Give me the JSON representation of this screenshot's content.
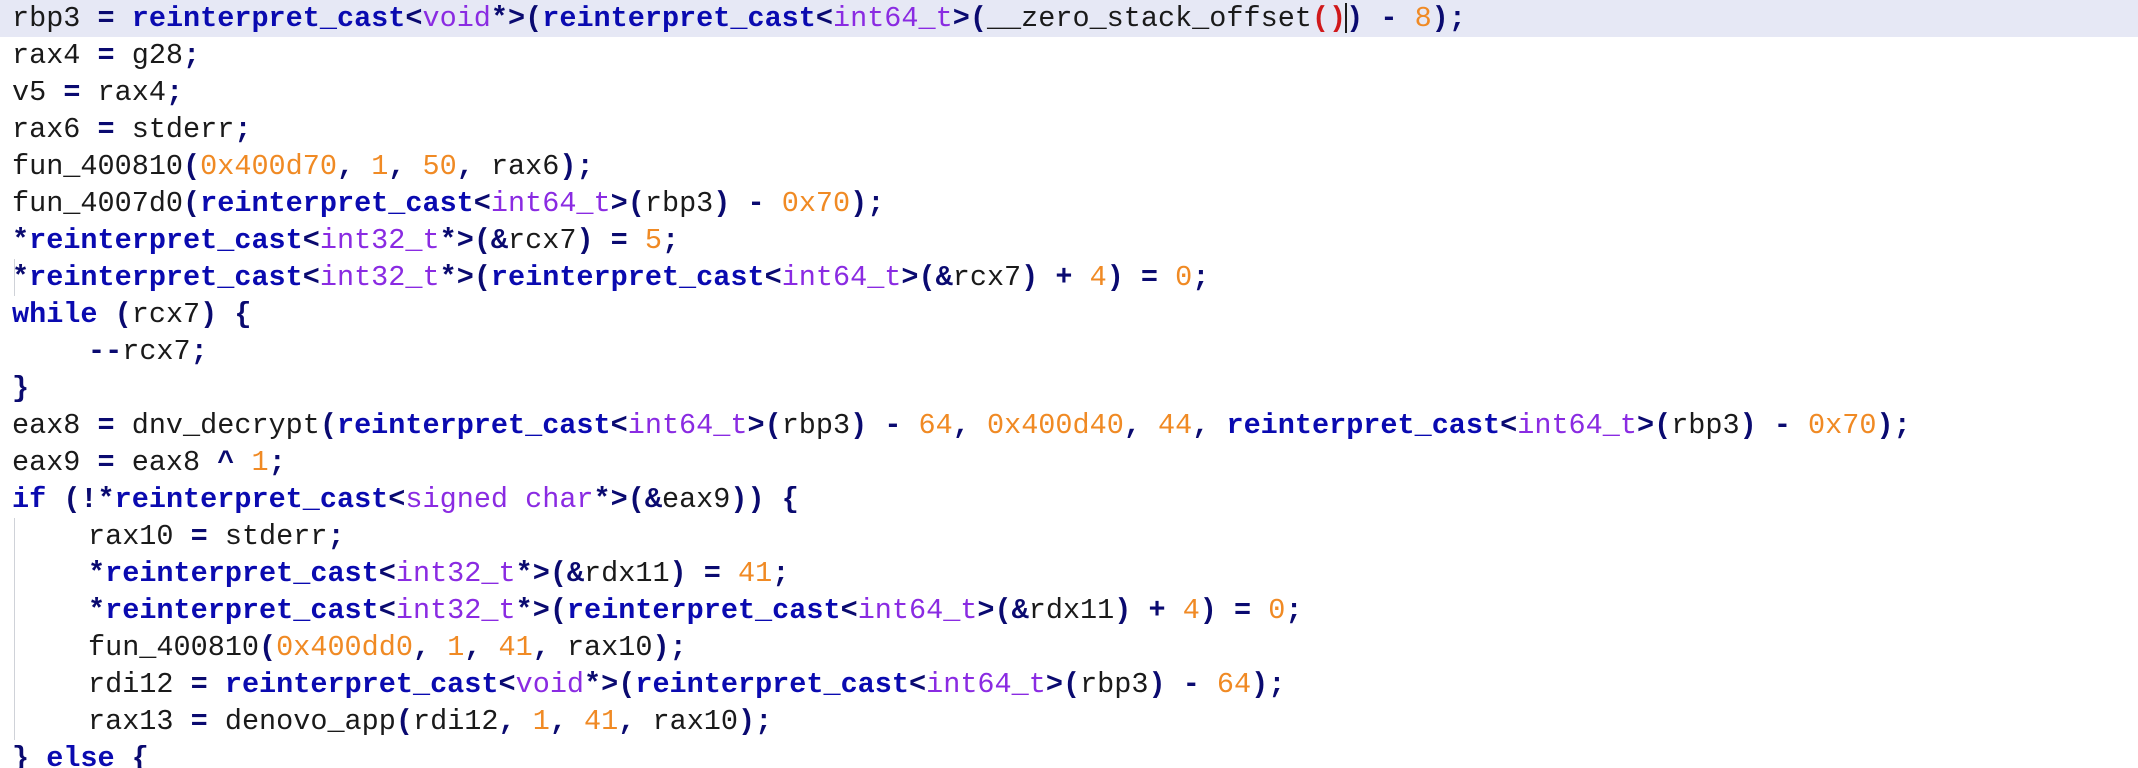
{
  "editor": {
    "lines": [
      {
        "indent": 0,
        "current": true,
        "tokens": [
          {
            "t": "rbp3 ",
            "c": "id"
          },
          {
            "t": "=",
            "c": "op"
          },
          {
            "t": " ",
            "c": "id"
          },
          {
            "t": "reinterpret_cast",
            "c": "kw"
          },
          {
            "t": "<",
            "c": "op"
          },
          {
            "t": "void",
            "c": "type"
          },
          {
            "t": "*>(",
            "c": "op"
          },
          {
            "t": "reinterpret_cast",
            "c": "kw"
          },
          {
            "t": "<",
            "c": "op"
          },
          {
            "t": "int64_t",
            "c": "type"
          },
          {
            "t": ">(",
            "c": "op"
          },
          {
            "t": "__zero_stack_offset",
            "c": "id"
          },
          {
            "t": "()",
            "c": "ctx"
          },
          {
            "t": "CURSOR",
            "c": "cursor"
          },
          {
            "t": ")",
            "c": "op"
          },
          {
            "t": " ",
            "c": "id"
          },
          {
            "t": "-",
            "c": "op"
          },
          {
            "t": " ",
            "c": "id"
          },
          {
            "t": "8",
            "c": "num"
          },
          {
            "t": ");",
            "c": "op"
          }
        ]
      },
      {
        "indent": 0,
        "tokens": [
          {
            "t": "rax4 ",
            "c": "id"
          },
          {
            "t": "=",
            "c": "op"
          },
          {
            "t": " g28",
            "c": "id"
          },
          {
            "t": ";",
            "c": "op"
          }
        ]
      },
      {
        "indent": 0,
        "tokens": [
          {
            "t": "v5 ",
            "c": "id"
          },
          {
            "t": "=",
            "c": "op"
          },
          {
            "t": " rax4",
            "c": "id"
          },
          {
            "t": ";",
            "c": "op"
          }
        ]
      },
      {
        "indent": 0,
        "tokens": [
          {
            "t": "rax6 ",
            "c": "id"
          },
          {
            "t": "=",
            "c": "op"
          },
          {
            "t": " stderr",
            "c": "id"
          },
          {
            "t": ";",
            "c": "op"
          }
        ]
      },
      {
        "indent": 0,
        "tokens": [
          {
            "t": "fun_400810",
            "c": "id"
          },
          {
            "t": "(",
            "c": "op"
          },
          {
            "t": "0x400d70",
            "c": "num"
          },
          {
            "t": ", ",
            "c": "op"
          },
          {
            "t": "1",
            "c": "num"
          },
          {
            "t": ", ",
            "c": "op"
          },
          {
            "t": "50",
            "c": "num"
          },
          {
            "t": ", ",
            "c": "op"
          },
          {
            "t": "rax6",
            "c": "id"
          },
          {
            "t": ");",
            "c": "op"
          }
        ]
      },
      {
        "indent": 0,
        "tokens": [
          {
            "t": "fun_4007d0",
            "c": "id"
          },
          {
            "t": "(",
            "c": "op"
          },
          {
            "t": "reinterpret_cast",
            "c": "kw"
          },
          {
            "t": "<",
            "c": "op"
          },
          {
            "t": "int64_t",
            "c": "type"
          },
          {
            "t": ">(",
            "c": "op"
          },
          {
            "t": "rbp3",
            "c": "id"
          },
          {
            "t": ")",
            "c": "op"
          },
          {
            "t": " ",
            "c": "id"
          },
          {
            "t": "-",
            "c": "op"
          },
          {
            "t": " ",
            "c": "id"
          },
          {
            "t": "0x70",
            "c": "num"
          },
          {
            "t": ");",
            "c": "op"
          }
        ]
      },
      {
        "indent": 0,
        "tokens": [
          {
            "t": "*",
            "c": "op"
          },
          {
            "t": "reinterpret_cast",
            "c": "kw"
          },
          {
            "t": "<",
            "c": "op"
          },
          {
            "t": "int32_t",
            "c": "type"
          },
          {
            "t": "*>(&",
            "c": "op"
          },
          {
            "t": "rcx7",
            "c": "id"
          },
          {
            "t": ")",
            "c": "op"
          },
          {
            "t": " ",
            "c": "id"
          },
          {
            "t": "=",
            "c": "op"
          },
          {
            "t": " ",
            "c": "id"
          },
          {
            "t": "5",
            "c": "num"
          },
          {
            "t": ";",
            "c": "op"
          }
        ]
      },
      {
        "indent": 0,
        "tokens": [
          {
            "t": "*",
            "c": "op"
          },
          {
            "t": "reinterpret_cast",
            "c": "kw"
          },
          {
            "t": "<",
            "c": "op"
          },
          {
            "t": "int32_t",
            "c": "type"
          },
          {
            "t": "*>(",
            "c": "op"
          },
          {
            "t": "reinterpret_cast",
            "c": "kw"
          },
          {
            "t": "<",
            "c": "op"
          },
          {
            "t": "int64_t",
            "c": "type"
          },
          {
            "t": ">(&",
            "c": "op"
          },
          {
            "t": "rcx7",
            "c": "id"
          },
          {
            "t": ")",
            "c": "op"
          },
          {
            "t": " ",
            "c": "id"
          },
          {
            "t": "+",
            "c": "op"
          },
          {
            "t": " ",
            "c": "id"
          },
          {
            "t": "4",
            "c": "num"
          },
          {
            "t": ")",
            "c": "op"
          },
          {
            "t": " ",
            "c": "id"
          },
          {
            "t": "=",
            "c": "op"
          },
          {
            "t": " ",
            "c": "id"
          },
          {
            "t": "0",
            "c": "num"
          },
          {
            "t": ";",
            "c": "op"
          }
        ]
      },
      {
        "indent": 0,
        "tokens": [
          {
            "t": "while",
            "c": "kw"
          },
          {
            "t": " (",
            "c": "op"
          },
          {
            "t": "rcx7",
            "c": "id"
          },
          {
            "t": ") {",
            "c": "op"
          }
        ]
      },
      {
        "indent": 1,
        "tokens": [
          {
            "t": "--",
            "c": "op"
          },
          {
            "t": "rcx7",
            "c": "id"
          },
          {
            "t": ";",
            "c": "op"
          }
        ]
      },
      {
        "indent": 0,
        "tokens": [
          {
            "t": "}",
            "c": "op"
          }
        ]
      },
      {
        "indent": 0,
        "tokens": [
          {
            "t": "eax8 ",
            "c": "id"
          },
          {
            "t": "=",
            "c": "op"
          },
          {
            "t": " dnv_decrypt",
            "c": "id"
          },
          {
            "t": "(",
            "c": "op"
          },
          {
            "t": "reinterpret_cast",
            "c": "kw"
          },
          {
            "t": "<",
            "c": "op"
          },
          {
            "t": "int64_t",
            "c": "type"
          },
          {
            "t": ">(",
            "c": "op"
          },
          {
            "t": "rbp3",
            "c": "id"
          },
          {
            "t": ")",
            "c": "op"
          },
          {
            "t": " ",
            "c": "id"
          },
          {
            "t": "-",
            "c": "op"
          },
          {
            "t": " ",
            "c": "id"
          },
          {
            "t": "64",
            "c": "num"
          },
          {
            "t": ", ",
            "c": "op"
          },
          {
            "t": "0x400d40",
            "c": "num"
          },
          {
            "t": ", ",
            "c": "op"
          },
          {
            "t": "44",
            "c": "num"
          },
          {
            "t": ", ",
            "c": "op"
          },
          {
            "t": "reinterpret_cast",
            "c": "kw"
          },
          {
            "t": "<",
            "c": "op"
          },
          {
            "t": "int64_t",
            "c": "type"
          },
          {
            "t": ">(",
            "c": "op"
          },
          {
            "t": "rbp3",
            "c": "id"
          },
          {
            "t": ")",
            "c": "op"
          },
          {
            "t": " ",
            "c": "id"
          },
          {
            "t": "-",
            "c": "op"
          },
          {
            "t": " ",
            "c": "id"
          },
          {
            "t": "0x70",
            "c": "num"
          },
          {
            "t": ");",
            "c": "op"
          }
        ]
      },
      {
        "indent": 0,
        "tokens": [
          {
            "t": "eax9 ",
            "c": "id"
          },
          {
            "t": "=",
            "c": "op"
          },
          {
            "t": " eax8 ",
            "c": "id"
          },
          {
            "t": "^",
            "c": "op"
          },
          {
            "t": " ",
            "c": "id"
          },
          {
            "t": "1",
            "c": "num"
          },
          {
            "t": ";",
            "c": "op"
          }
        ]
      },
      {
        "indent": 0,
        "tokens": [
          {
            "t": "if",
            "c": "kw"
          },
          {
            "t": " (!*",
            "c": "op"
          },
          {
            "t": "reinterpret_cast",
            "c": "kw"
          },
          {
            "t": "<",
            "c": "op"
          },
          {
            "t": "signed char",
            "c": "type"
          },
          {
            "t": "*>(&",
            "c": "op"
          },
          {
            "t": "eax9",
            "c": "id"
          },
          {
            "t": ")) {",
            "c": "op"
          }
        ]
      },
      {
        "indent": 1,
        "tokens": [
          {
            "t": "rax10 ",
            "c": "id"
          },
          {
            "t": "=",
            "c": "op"
          },
          {
            "t": " stderr",
            "c": "id"
          },
          {
            "t": ";",
            "c": "op"
          }
        ]
      },
      {
        "indent": 1,
        "tokens": [
          {
            "t": "*",
            "c": "op"
          },
          {
            "t": "reinterpret_cast",
            "c": "kw"
          },
          {
            "t": "<",
            "c": "op"
          },
          {
            "t": "int32_t",
            "c": "type"
          },
          {
            "t": "*>(&",
            "c": "op"
          },
          {
            "t": "rdx11",
            "c": "id"
          },
          {
            "t": ")",
            "c": "op"
          },
          {
            "t": " ",
            "c": "id"
          },
          {
            "t": "=",
            "c": "op"
          },
          {
            "t": " ",
            "c": "id"
          },
          {
            "t": "41",
            "c": "num"
          },
          {
            "t": ";",
            "c": "op"
          }
        ]
      },
      {
        "indent": 1,
        "tokens": [
          {
            "t": "*",
            "c": "op"
          },
          {
            "t": "reinterpret_cast",
            "c": "kw"
          },
          {
            "t": "<",
            "c": "op"
          },
          {
            "t": "int32_t",
            "c": "type"
          },
          {
            "t": "*>(",
            "c": "op"
          },
          {
            "t": "reinterpret_cast",
            "c": "kw"
          },
          {
            "t": "<",
            "c": "op"
          },
          {
            "t": "int64_t",
            "c": "type"
          },
          {
            "t": ">(&",
            "c": "op"
          },
          {
            "t": "rdx11",
            "c": "id"
          },
          {
            "t": ")",
            "c": "op"
          },
          {
            "t": " ",
            "c": "id"
          },
          {
            "t": "+",
            "c": "op"
          },
          {
            "t": " ",
            "c": "id"
          },
          {
            "t": "4",
            "c": "num"
          },
          {
            "t": ")",
            "c": "op"
          },
          {
            "t": " ",
            "c": "id"
          },
          {
            "t": "=",
            "c": "op"
          },
          {
            "t": " ",
            "c": "id"
          },
          {
            "t": "0",
            "c": "num"
          },
          {
            "t": ";",
            "c": "op"
          }
        ]
      },
      {
        "indent": 1,
        "tokens": [
          {
            "t": "fun_400810",
            "c": "id"
          },
          {
            "t": "(",
            "c": "op"
          },
          {
            "t": "0x400dd0",
            "c": "num"
          },
          {
            "t": ", ",
            "c": "op"
          },
          {
            "t": "1",
            "c": "num"
          },
          {
            "t": ", ",
            "c": "op"
          },
          {
            "t": "41",
            "c": "num"
          },
          {
            "t": ", ",
            "c": "op"
          },
          {
            "t": "rax10",
            "c": "id"
          },
          {
            "t": ");",
            "c": "op"
          }
        ]
      },
      {
        "indent": 1,
        "tokens": [
          {
            "t": "rdi12 ",
            "c": "id"
          },
          {
            "t": "=",
            "c": "op"
          },
          {
            "t": " ",
            "c": "id"
          },
          {
            "t": "reinterpret_cast",
            "c": "kw"
          },
          {
            "t": "<",
            "c": "op"
          },
          {
            "t": "void",
            "c": "type"
          },
          {
            "t": "*>(",
            "c": "op"
          },
          {
            "t": "reinterpret_cast",
            "c": "kw"
          },
          {
            "t": "<",
            "c": "op"
          },
          {
            "t": "int64_t",
            "c": "type"
          },
          {
            "t": ">(",
            "c": "op"
          },
          {
            "t": "rbp3",
            "c": "id"
          },
          {
            "t": ")",
            "c": "op"
          },
          {
            "t": " ",
            "c": "id"
          },
          {
            "t": "-",
            "c": "op"
          },
          {
            "t": " ",
            "c": "id"
          },
          {
            "t": "64",
            "c": "num"
          },
          {
            "t": ");",
            "c": "op"
          }
        ]
      },
      {
        "indent": 1,
        "tokens": [
          {
            "t": "rax13 ",
            "c": "id"
          },
          {
            "t": "=",
            "c": "op"
          },
          {
            "t": " denovo_app",
            "c": "id"
          },
          {
            "t": "(",
            "c": "op"
          },
          {
            "t": "rdi12",
            "c": "id"
          },
          {
            "t": ", ",
            "c": "op"
          },
          {
            "t": "1",
            "c": "num"
          },
          {
            "t": ", ",
            "c": "op"
          },
          {
            "t": "41",
            "c": "num"
          },
          {
            "t": ", ",
            "c": "op"
          },
          {
            "t": "rax10",
            "c": "id"
          },
          {
            "t": ");",
            "c": "op"
          }
        ]
      },
      {
        "indent": 0,
        "tokens": [
          {
            "t": "} ",
            "c": "op"
          },
          {
            "t": "else",
            "c": "kw"
          },
          {
            "t": " {",
            "c": "op"
          }
        ]
      }
    ]
  }
}
